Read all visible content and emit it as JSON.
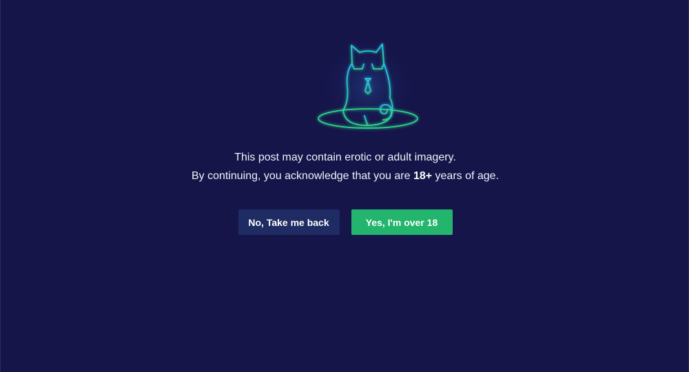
{
  "illustration": {
    "icon": "neon-cat-with-sunglasses-icon",
    "glow_color": "#20c7e6",
    "accent_color": "#2fd38a"
  },
  "message": {
    "line1": "This post may contain erotic or adult imagery.",
    "line2_before": "By continuing, you acknowledge that you are ",
    "line2_bold": "18+",
    "line2_after": " years of age."
  },
  "actions": {
    "no_label": "No, Take me back",
    "yes_label": "Yes, I'm over 18"
  },
  "colors": {
    "background": "#15154a",
    "no_button": "#1f2b63",
    "yes_button": "#23b46e"
  }
}
